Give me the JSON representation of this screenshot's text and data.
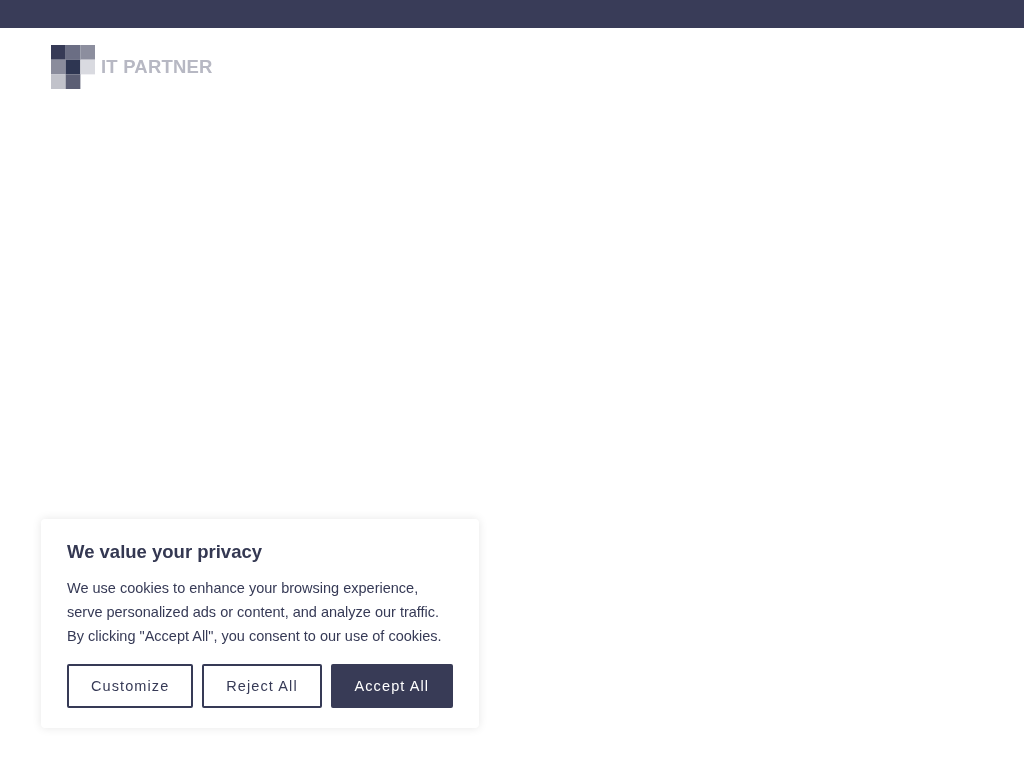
{
  "header": {
    "logo": {
      "text": "IT PARTNER"
    }
  },
  "cookie_banner": {
    "title": "We value your privacy",
    "text": "We use cookies to enhance your browsing experience, serve personalized ads or content, and analyze our traffic. By clicking \"Accept All\", you consent to our use of cookies.",
    "buttons": [
      {
        "label": "Customize",
        "kind": "outline"
      },
      {
        "label": "Reject All",
        "kind": "outline"
      },
      {
        "label": "Accept All",
        "kind": "filled"
      }
    ]
  }
}
